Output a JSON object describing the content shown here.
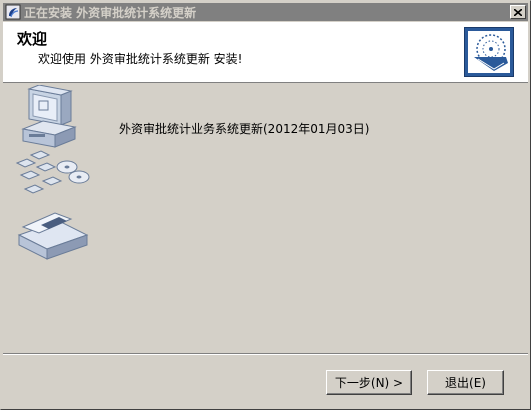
{
  "window": {
    "title": "正在安装 外资审批统计系统更新"
  },
  "header": {
    "title": "欢迎",
    "subtitle": "欢迎使用 外资审批统计系统更新 安装!"
  },
  "main": {
    "product_line": "外资审批统计业务系统更新(2012年01月03日)"
  },
  "buttons": {
    "next_label": "下一步(N) >",
    "exit_label": "退出(E)"
  },
  "icons": {
    "title_icon": "installer-app-icon",
    "close_icon": "close-icon",
    "header_logo": "installer-logo-icon",
    "side_art": "computer-and-discs-illustration"
  },
  "colors": {
    "face": "#d4d0c8",
    "titlebar_inactive": "#808080",
    "header_bg": "#ffffff",
    "logo_blue": "#2b5a9a"
  }
}
